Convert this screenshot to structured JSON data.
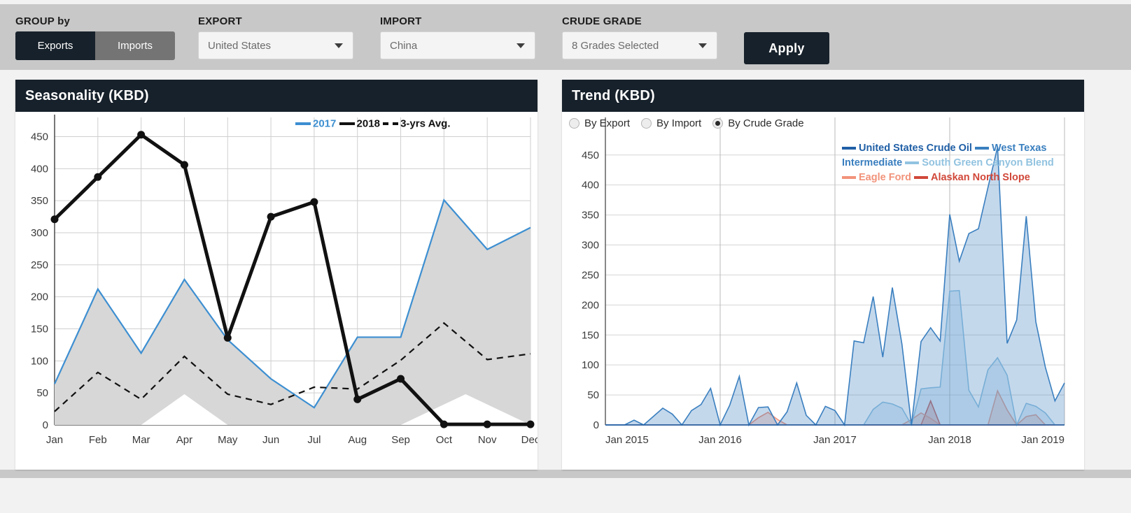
{
  "toolbar": {
    "group_by": {
      "label": "GROUP by",
      "options": [
        "Exports",
        "Imports"
      ],
      "selected": "Exports"
    },
    "export": {
      "label": "EXPORT",
      "value": "United States"
    },
    "import": {
      "label": "IMPORT",
      "value": "China"
    },
    "crude_grade": {
      "label": "CRUDE GRADE",
      "value": "8 Grades Selected"
    },
    "apply_label": "Apply"
  },
  "seasonality_panel": {
    "title": "Seasonality (KBD)"
  },
  "trend_panel": {
    "title": "Trend (KBD)",
    "radios": [
      {
        "label": "By Export",
        "selected": false
      },
      {
        "label": "By Import",
        "selected": false
      },
      {
        "label": "By Crude Grade",
        "selected": true
      }
    ]
  },
  "colors": {
    "panel_header": "#17212b",
    "page_bg": "#c8c8c8",
    "accent_2017": "#3d8fd1",
    "accent_2018": "#111111",
    "band_fill": "#d7d7d7",
    "us_crude_oil": "#1f5fa6",
    "west_texas": "#3a7fbf",
    "south_green_canyon": "#92c3e0",
    "eagle_ford": "#f2937a",
    "alaskan_north_slope": "#d1483a"
  },
  "chart_data": [
    {
      "type": "line",
      "id": "seasonality",
      "title": "Seasonality (KBD)",
      "xlabel": "",
      "ylabel": "",
      "ylim": [
        0,
        480
      ],
      "yticks": [
        0,
        50,
        100,
        150,
        200,
        250,
        300,
        350,
        400,
        450
      ],
      "grid": true,
      "legend_position": "top-right",
      "categories": [
        "Jan",
        "Feb",
        "Mar",
        "Apr",
        "May",
        "Jun",
        "Jul",
        "Aug",
        "Sep",
        "Oct",
        "Nov",
        "Dec"
      ],
      "series": [
        {
          "name": "2017",
          "color": "#3d8fd1",
          "style": "solid",
          "filled": true,
          "values": [
            64,
            212,
            112,
            227,
            133,
            72,
            27,
            137,
            137,
            351,
            274,
            308
          ]
        },
        {
          "name": "2018",
          "color": "#111111",
          "style": "solid",
          "markers": true,
          "values": [
            321,
            387,
            453,
            406,
            136,
            325,
            348,
            40,
            72,
            1,
            1,
            1
          ]
        },
        {
          "name": "3-yrs Avg.",
          "color": "#111111",
          "style": "dashed",
          "values": [
            21,
            82,
            40,
            107,
            48,
            32,
            59,
            56,
            101,
            159,
            102,
            111
          ]
        }
      ]
    },
    {
      "type": "area",
      "id": "trend",
      "title": "Trend (KBD)",
      "xlabel": "",
      "ylabel": "",
      "ylim": [
        0,
        480
      ],
      "yticks": [
        0,
        50,
        100,
        150,
        200,
        250,
        300,
        350,
        400,
        450
      ],
      "grid": true,
      "legend_position": "top-right",
      "xtick_labels": [
        "Jan 2015",
        "Jan 2016",
        "Jan 2017",
        "Jan 2018",
        "Jan 2019"
      ],
      "xtick_positions": [
        0,
        12,
        24,
        36,
        48
      ],
      "n_points": 49,
      "series": [
        {
          "name": "United States Crude Oil",
          "color": "#1f5fa6",
          "values": [
            0,
            0,
            0,
            0,
            0,
            0,
            0,
            0,
            0,
            0,
            0,
            0,
            0,
            0,
            0,
            0,
            0,
            0,
            0,
            0,
            0,
            0,
            0,
            0,
            0,
            0,
            0,
            0,
            0,
            0,
            0,
            0,
            0,
            0,
            0,
            0,
            0,
            0,
            0,
            0,
            0,
            0,
            0,
            0,
            0,
            0,
            0,
            0,
            0
          ]
        },
        {
          "name": "West Texas Intermediate",
          "color": "#3a7fbf",
          "values": [
            0,
            0,
            0,
            8,
            0,
            14,
            28,
            18,
            0,
            24,
            34,
            61,
            0,
            33,
            81,
            0,
            29,
            30,
            0,
            22,
            70,
            16,
            0,
            31,
            24,
            0,
            140,
            137,
            214,
            113,
            229,
            135,
            0,
            139,
            162,
            140,
            351,
            273,
            319,
            327,
            396,
            463,
            136,
            175,
            348,
            172,
            96,
            40,
            70
          ]
        },
        {
          "name": "South Green Canyon Blend",
          "color": "#92c3e0",
          "values": [
            0,
            0,
            0,
            0,
            0,
            0,
            0,
            0,
            0,
            0,
            0,
            0,
            0,
            0,
            0,
            0,
            0,
            0,
            0,
            0,
            0,
            0,
            0,
            0,
            0,
            0,
            0,
            0,
            26,
            38,
            35,
            28,
            0,
            60,
            62,
            63,
            223,
            224,
            58,
            30,
            92,
            112,
            83,
            0,
            36,
            31,
            20,
            0,
            0
          ]
        },
        {
          "name": "Eagle Ford",
          "color": "#f2937a",
          "values": [
            0,
            0,
            0,
            0,
            0,
            0,
            0,
            0,
            0,
            0,
            0,
            0,
            0,
            0,
            0,
            0,
            12,
            21,
            9,
            0,
            0,
            0,
            0,
            0,
            0,
            0,
            0,
            0,
            0,
            0,
            0,
            0,
            9,
            20,
            11,
            0,
            0,
            0,
            0,
            0,
            0,
            57,
            25,
            0,
            14,
            17,
            0,
            0,
            0
          ]
        },
        {
          "name": "Alaskan North Slope",
          "color": "#d1483a",
          "values": [
            0,
            0,
            0,
            0,
            0,
            0,
            0,
            0,
            0,
            0,
            0,
            0,
            0,
            0,
            0,
            0,
            0,
            0,
            0,
            0,
            0,
            0,
            0,
            0,
            0,
            0,
            0,
            0,
            0,
            0,
            0,
            0,
            0,
            0,
            40,
            0,
            0,
            0,
            0,
            0,
            0,
            0,
            0,
            0,
            0,
            0,
            0,
            0,
            0
          ]
        }
      ]
    }
  ]
}
